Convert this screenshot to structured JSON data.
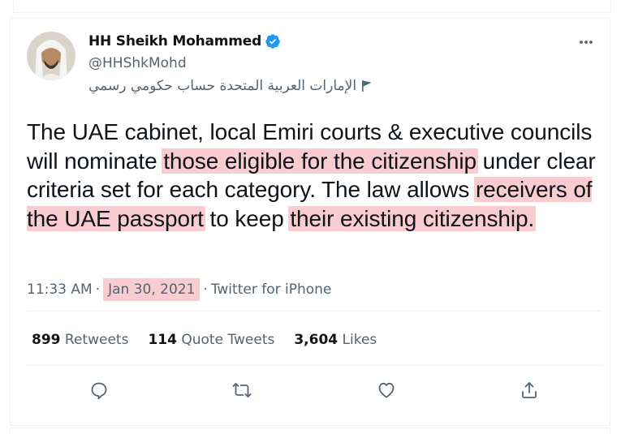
{
  "tweet": {
    "author_name": "HH Sheikh Mohammed",
    "handle": "@HHShkMohd",
    "affiliation": "الإمارات العربية المتحدة حساب حكومي رسمي",
    "text_parts": [
      "The UAE cabinet, local Emiri courts & executive councils will nominate ",
      "those eligible for the citizenship",
      " under clear criteria set for each category. The law allows ",
      "receivers of the UAE passport",
      " to keep ",
      "their existing citizenship."
    ],
    "time": "11:33 AM",
    "date": "Jan 30, 2021",
    "separator": "·",
    "source": "Twitter for iPhone"
  },
  "stats": {
    "retweets_count": "899",
    "retweets_label": "Retweets",
    "quotes_count": "114",
    "quotes_label": "Quote Tweets",
    "likes_count": "3,604",
    "likes_label": "Likes"
  },
  "icons": {
    "verified": "verified-badge-icon",
    "more": "more-options-icon",
    "reply": "reply-icon",
    "retweet": "retweet-icon",
    "like": "like-icon",
    "share": "share-icon",
    "flag": "flag-icon"
  },
  "colors": {
    "highlight": "#f9cdd0",
    "verified_blue": "#1d9bf0",
    "secondary_text": "#536471"
  }
}
